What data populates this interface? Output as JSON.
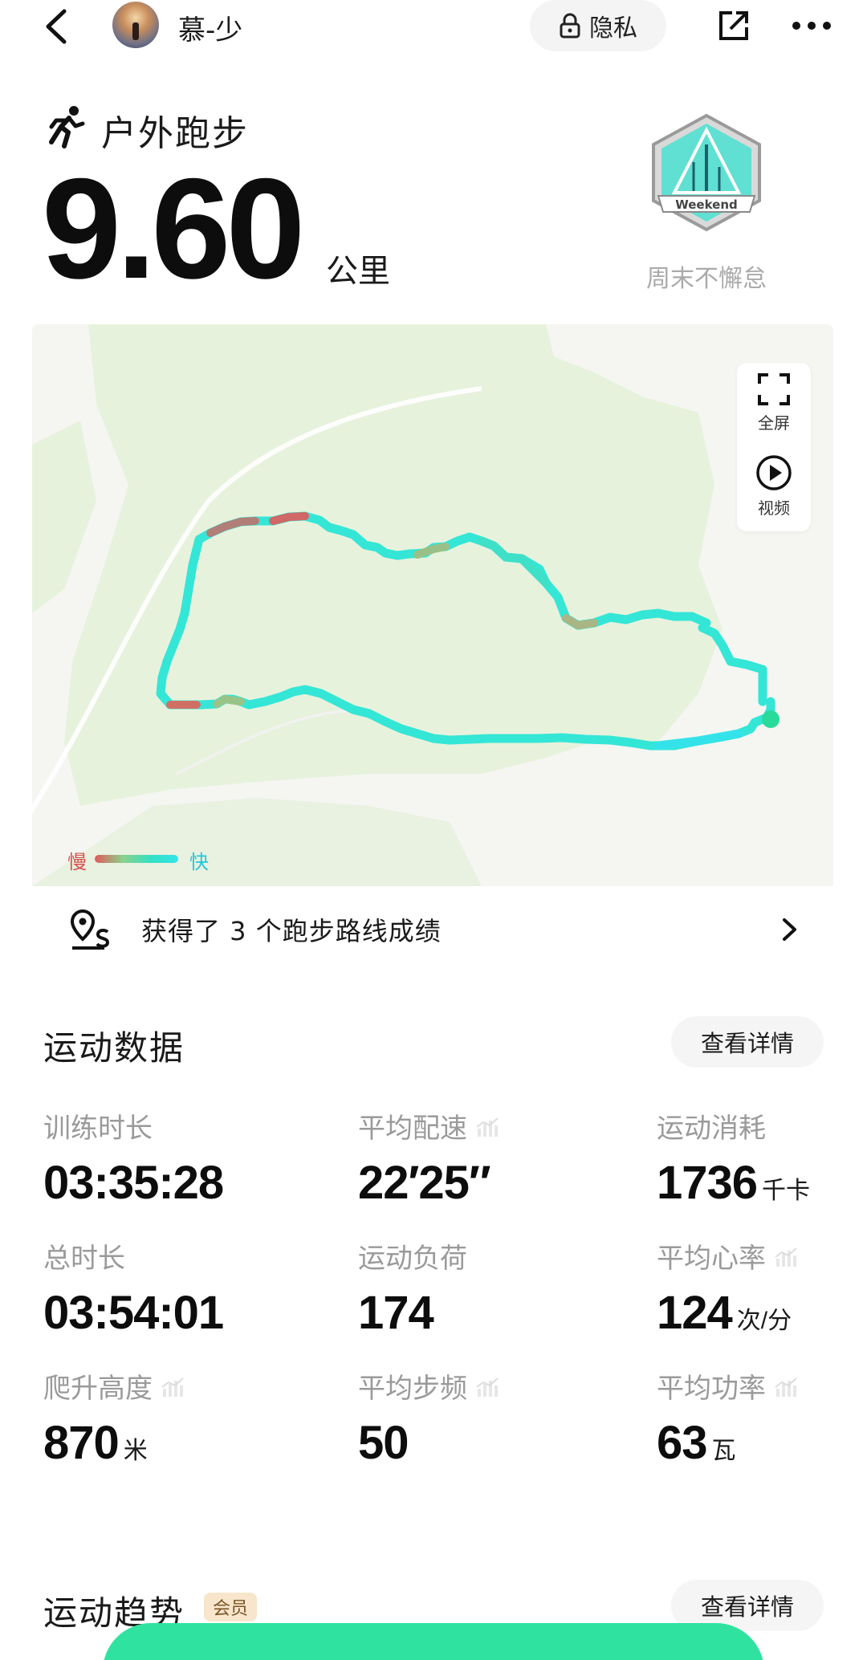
{
  "topbar": {
    "username": "慕-少",
    "privacy_label": "隐私",
    "icons": [
      "back-arrow-icon",
      "lock-icon",
      "share-icon",
      "more-icon"
    ]
  },
  "activity": {
    "type": "户外跑步",
    "distance": "9.60",
    "distance_unit": "公里",
    "badge_text": "Weekend",
    "badge_label": "周末不懈怠"
  },
  "map": {
    "fullscreen_label": "全屏",
    "video_label": "视频",
    "legend_slow": "慢",
    "legend_fast": "快",
    "route_achievement": "获得了 3 个跑步路线成绩"
  },
  "stats": {
    "title": "运动数据",
    "detail_label": "查看详情",
    "items": [
      {
        "label": "训练时长",
        "value": "03:35:28",
        "unit": "",
        "trend": false
      },
      {
        "label": "平均配速",
        "value": "22′25″",
        "unit": "",
        "trend": true
      },
      {
        "label": "运动消耗",
        "value": "1736",
        "unit": "千卡",
        "trend": false
      },
      {
        "label": "总时长",
        "value": "03:54:01",
        "unit": "",
        "trend": false
      },
      {
        "label": "运动负荷",
        "value": "174",
        "unit": "",
        "trend": false
      },
      {
        "label": "平均心率",
        "value": "124",
        "unit": "次/分",
        "trend": true
      },
      {
        "label": "爬升高度",
        "value": "870",
        "unit": "米",
        "trend": true
      },
      {
        "label": "平均步频",
        "value": "50",
        "unit": "",
        "trend": true
      },
      {
        "label": "平均功率",
        "value": "63",
        "unit": "瓦",
        "trend": true
      }
    ]
  },
  "trend": {
    "title": "运动趋势",
    "member_tag": "会员",
    "detail_label": "查看详情"
  },
  "colors": {
    "route_slow": "#e05a5a",
    "route_fast": "#34e3ea",
    "map_green": "#e7f2dd",
    "bottom_button": "#2fe2a0"
  }
}
